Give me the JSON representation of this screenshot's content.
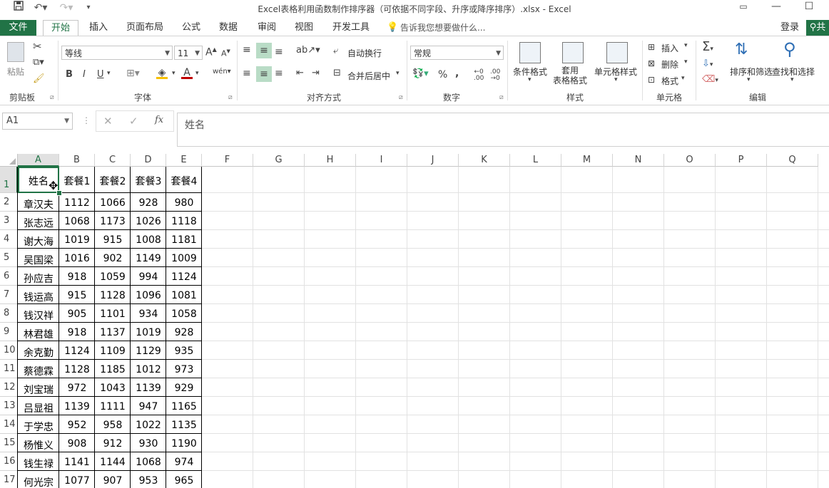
{
  "window": {
    "title": "Excel表格利用函数制作排序器（可依据不同字段、升序或降序排序）.xlsx - Excel"
  },
  "tabs": {
    "file": "文件",
    "home": "开始",
    "insert": "插入",
    "layout": "页面布局",
    "formulas": "公式",
    "data": "数据",
    "review": "审阅",
    "view": "视图",
    "developer": "开发工具",
    "tellme": "告诉我您想要做什么...",
    "login": "登录",
    "share": "共"
  },
  "ribbon": {
    "clipboard": {
      "paste": "粘贴",
      "group": "剪贴板"
    },
    "font": {
      "name": "等线",
      "size": "11",
      "group": "字体",
      "bold": "B",
      "italic": "I",
      "underline": "U"
    },
    "alignment": {
      "wrap": "自动换行",
      "merge": "合并后居中",
      "group": "对齐方式"
    },
    "number": {
      "format": "常规",
      "percent": "%",
      "comma": ",",
      "group": "数字"
    },
    "styles": {
      "conditional": "条件格式",
      "table_format_1": "套用",
      "table_format_2": "表格格式",
      "cell_style": "单元格样式",
      "group": "样式"
    },
    "cells": {
      "insert": "插入",
      "delete": "删除",
      "format": "格式",
      "group": "单元格"
    },
    "editing": {
      "sort": "排序和筛选",
      "find": "查找和选择",
      "group": "编辑"
    }
  },
  "formula_bar": {
    "name_box": "A1",
    "fx": "fx",
    "content": "姓名"
  },
  "sheet": {
    "columns": [
      "A",
      "B",
      "C",
      "D",
      "E",
      "F",
      "G",
      "H",
      "I",
      "J",
      "K",
      "L",
      "M",
      "N",
      "O",
      "P",
      "Q"
    ],
    "row_numbers": [
      "1",
      "2",
      "3",
      "4",
      "5",
      "6",
      "7",
      "8",
      "9",
      "10",
      "11",
      "12",
      "13",
      "14",
      "15",
      "16",
      "17"
    ],
    "rows": [
      [
        "姓名",
        "套餐1",
        "套餐2",
        "套餐3",
        "套餐4"
      ],
      [
        "章汉夫",
        "1112",
        "1066",
        "928",
        "980"
      ],
      [
        "张志远",
        "1068",
        "1173",
        "1026",
        "1118"
      ],
      [
        "谢大海",
        "1019",
        "915",
        "1008",
        "1181"
      ],
      [
        "吴国梁",
        "1016",
        "902",
        "1149",
        "1009"
      ],
      [
        "孙应吉",
        "918",
        "1059",
        "994",
        "1124"
      ],
      [
        "钱运高",
        "915",
        "1128",
        "1096",
        "1081"
      ],
      [
        "钱汉祥",
        "905",
        "1101",
        "934",
        "1058"
      ],
      [
        "林君雄",
        "918",
        "1137",
        "1019",
        "928"
      ],
      [
        "余克勤",
        "1124",
        "1109",
        "1129",
        "935"
      ],
      [
        "蔡德霖",
        "1128",
        "1185",
        "1012",
        "973"
      ],
      [
        "刘宝瑞",
        "972",
        "1043",
        "1139",
        "929"
      ],
      [
        "吕显祖",
        "1139",
        "1111",
        "947",
        "1165"
      ],
      [
        "于学忠",
        "952",
        "958",
        "1022",
        "1135"
      ],
      [
        "杨惟义",
        "908",
        "912",
        "930",
        "1190"
      ],
      [
        "钱生禄",
        "1141",
        "1144",
        "1068",
        "974"
      ],
      [
        "何光宗",
        "1077",
        "907",
        "953",
        "965"
      ]
    ]
  }
}
